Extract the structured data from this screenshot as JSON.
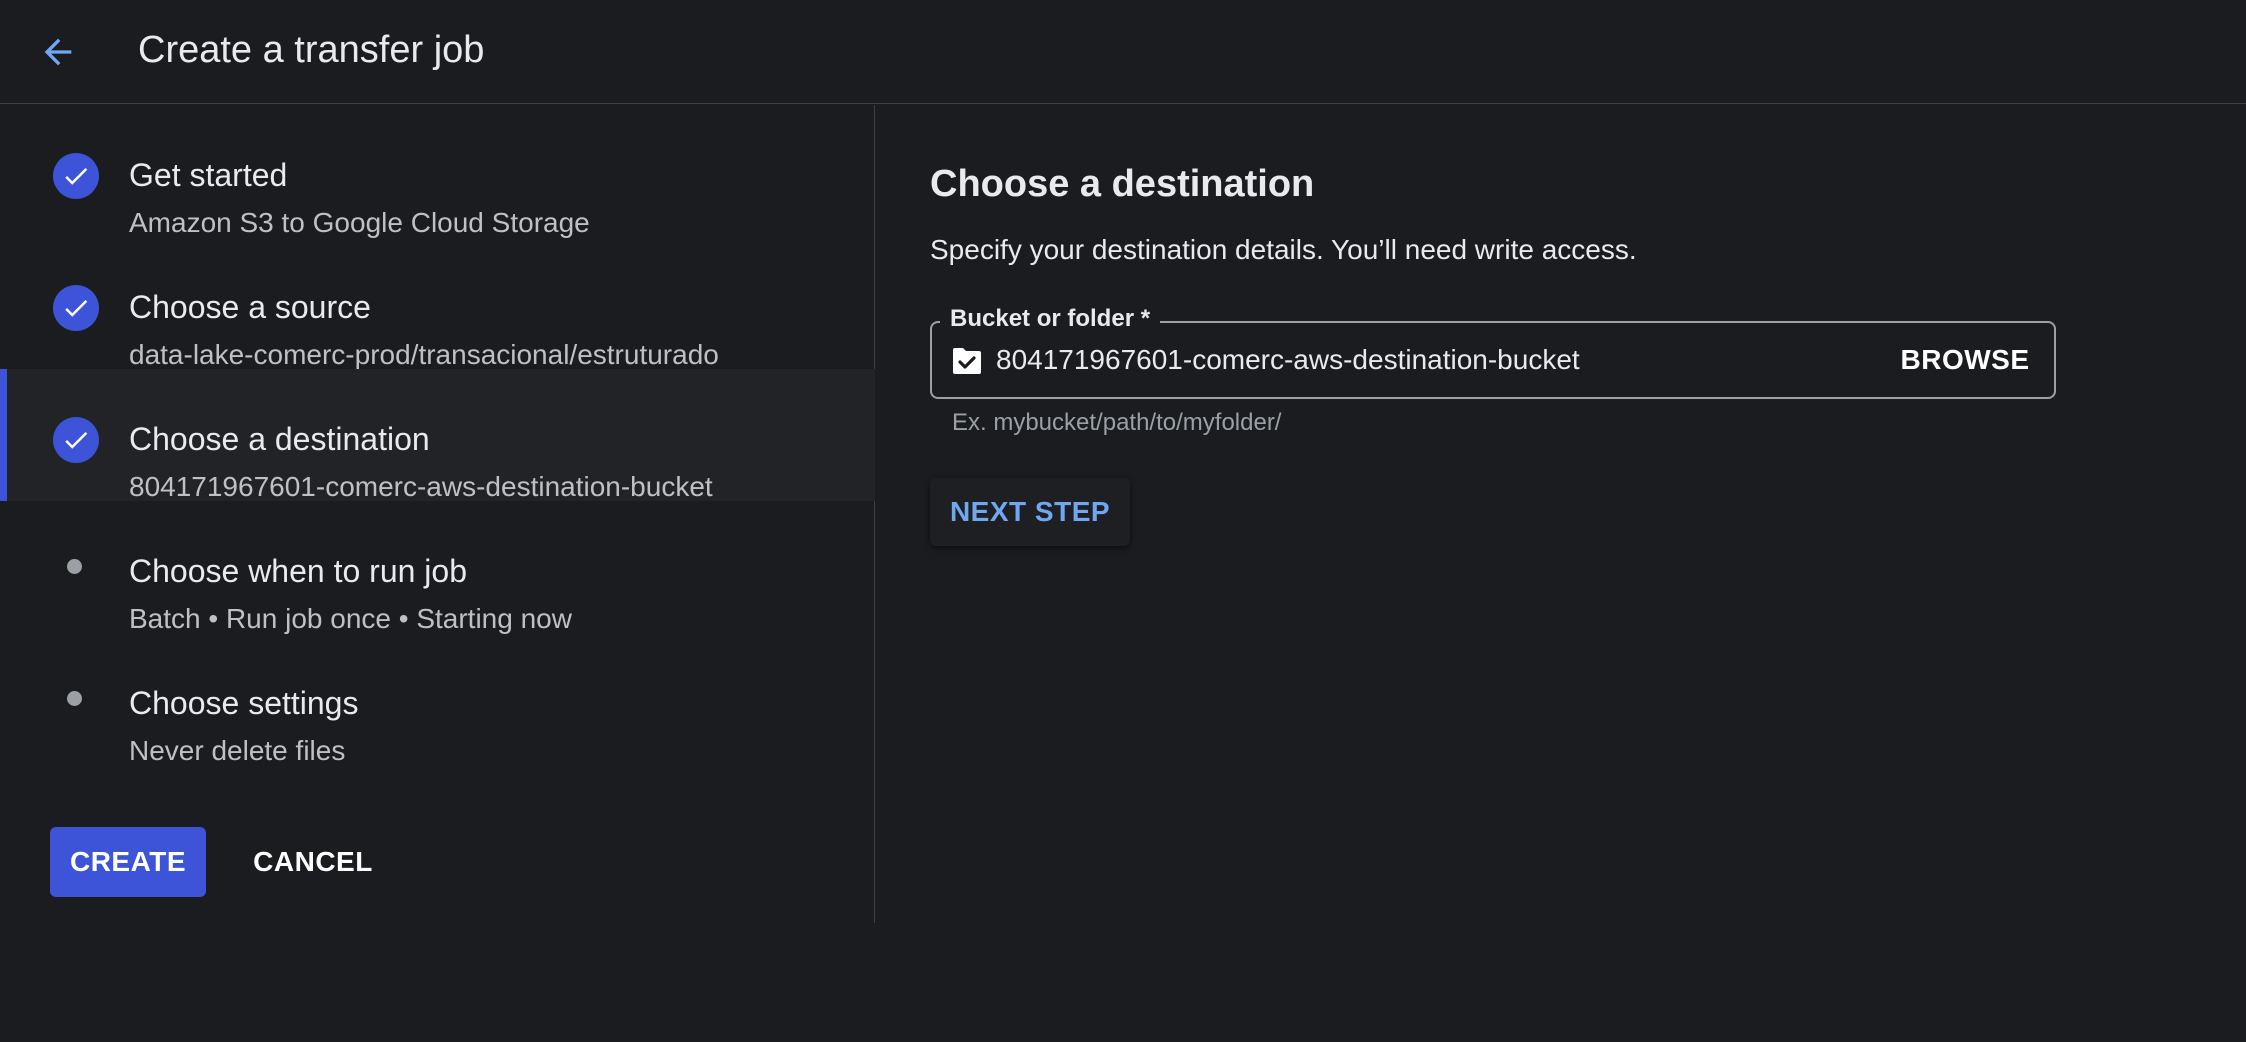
{
  "header": {
    "title": "Create a transfer job",
    "back_icon": "arrow-back-icon"
  },
  "steps": [
    {
      "title": "Get started",
      "subtitle": "Amazon S3 to Google Cloud Storage",
      "status": "complete"
    },
    {
      "title": "Choose a source",
      "subtitle": "data-lake-comerc-prod/transacional/estruturado",
      "status": "complete"
    },
    {
      "title": "Choose a destination",
      "subtitle": "804171967601-comerc-aws-destination-bucket",
      "status": "current"
    },
    {
      "title": "Choose when to run job",
      "subtitle": "Batch • Run job once • Starting now",
      "status": "pending"
    },
    {
      "title": "Choose settings",
      "subtitle": "Never delete files",
      "status": "pending"
    }
  ],
  "actions": {
    "create_label": "CREATE",
    "cancel_label": "CANCEL"
  },
  "main": {
    "title": "Choose a destination",
    "description": "Specify your destination details. You’ll need write access.",
    "field": {
      "label": "Bucket or folder *",
      "value": "804171967601-comerc-aws-destination-bucket",
      "hint": "Ex. mybucket/path/to/myfolder/",
      "icon": "folder-check-icon",
      "browse_label": "BROWSE"
    },
    "next_label": "NEXT STEP"
  },
  "colors": {
    "background": "#1b1c1f",
    "accent": "#3d53d8",
    "link": "#6fa8f0",
    "border": "#3c4043"
  }
}
